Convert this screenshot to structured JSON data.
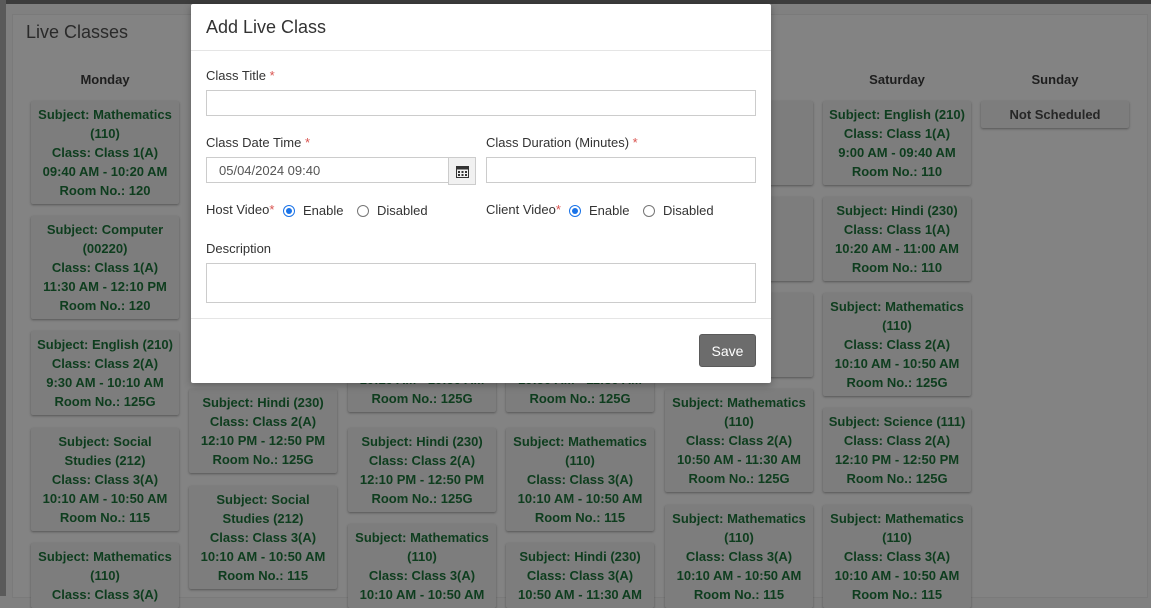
{
  "page": {
    "title": "Live Classes"
  },
  "days": [
    "Monday",
    "Saturday",
    "Sunday"
  ],
  "schedule": {
    "monday": [
      [
        "Subject: Mathematics",
        "(110)",
        "Class: Class 1(A)",
        "09:40 AM - 10:20 AM",
        "Room No.: 120"
      ],
      [
        "Subject: Computer",
        "(00220)",
        "Class: Class 1(A)",
        "11:30 AM - 12:10 PM",
        "Room No.: 120"
      ],
      [
        "Subject: English (210)",
        "Class: Class 2(A)",
        "9:30 AM - 10:10 AM",
        "Room No.: 125G"
      ],
      [
        "Subject: Social",
        "Studies (212)",
        "Class: Class 3(A)",
        "10:10 AM - 10:50 AM",
        "Room No.: 115"
      ],
      [
        "Subject: Mathematics",
        "(110)",
        "Class: Class 3(A)"
      ]
    ],
    "tuesday": [
      [
        "Subject: Hindi (230)",
        "Class: Class 2(A)",
        "12:10 PM - 12:50 PM",
        "Room No.: 125G"
      ],
      [
        "Subject: Social",
        "Studies (212)",
        "Class: Class 3(A)",
        "10:10 AM - 10:50 AM",
        "Room No.: 115"
      ]
    ],
    "wednesday": [
      [
        "10:10 AM - 10:50 AM",
        "Room No.: 125G"
      ],
      [
        "Subject: Hindi (230)",
        "Class: Class 2(A)",
        "12:10 PM - 12:50 PM",
        "Room No.: 125G"
      ],
      [
        "Subject: Mathematics",
        "(110)",
        "Class: Class 3(A)",
        "10:10 AM - 10:50 AM"
      ]
    ],
    "thursday": [
      [
        "10:50 AM - 11:30 AM",
        "Room No.: 125G"
      ],
      [
        "Subject: Mathematics",
        "(110)",
        "Class: Class 3(A)",
        "10:10 AM - 10:50 AM",
        "Room No.: 115"
      ],
      [
        "Subject: Hindi (230)",
        "Class: Class 3(A)",
        "10:50 AM - 11:30 AM"
      ]
    ],
    "friday": [
      [
        "(210)",
        "(A)",
        "0 AM",
        "10"
      ],
      [
        "(200)",
        "(A)",
        "0 PM",
        "10"
      ],
      [
        "(111)",
        "(A)",
        "0 AM",
        "5G"
      ],
      [
        "Subject: Mathematics",
        "(110)",
        "Class: Class 2(A)",
        "10:50 AM - 11:30 AM",
        "Room No.: 125G"
      ],
      [
        "Subject: Mathematics",
        "(110)",
        "Class: Class 3(A)",
        "10:10 AM - 10:50 AM",
        "Room No.: 115"
      ]
    ],
    "saturday": [
      [
        "Subject: English (210)",
        "Class: Class 1(A)",
        "9:00 AM - 09:40 AM",
        "Room No.: 110"
      ],
      [
        "Subject: Hindi (230)",
        "Class: Class 1(A)",
        "10:20 AM - 11:00 AM",
        "Room No.: 110"
      ],
      [
        "Subject: Mathematics",
        "(110)",
        "Class: Class 2(A)",
        "10:10 AM - 10:50 AM",
        "Room No.: 125G"
      ],
      [
        "Subject: Science (111)",
        "Class: Class 2(A)",
        "12:10 PM - 12:50 PM",
        "Room No.: 125G"
      ],
      [
        "Subject: Mathematics",
        "(110)",
        "Class: Class 3(A)",
        "10:10 AM - 10:50 AM",
        "Room No.: 115"
      ]
    ],
    "sunday": [
      [
        "Not Scheduled"
      ]
    ]
  },
  "modal": {
    "title": "Add Live Class",
    "class_title_label": "Class Title",
    "class_title_value": "",
    "date_time_label": "Class Date Time",
    "date_time_value": "05/04/2024 09:40",
    "duration_label": "Class Duration (Minutes)",
    "duration_value": "",
    "host_video_label": "Host Video",
    "client_video_label": "Client Video",
    "enable_label": "Enable",
    "disabled_label": "Disabled",
    "host_video_selected": "Enable",
    "client_video_selected": "Enable",
    "description_label": "Description",
    "description_value": "",
    "required_mark": "*",
    "save_label": "Save"
  },
  "icons": {
    "calendar": "calendar-icon"
  },
  "colors": {
    "subject_text": "#0e3d1e",
    "required": "#d9534f",
    "radio_selected": "#1a73e8",
    "save_button": "#6c6c6c"
  }
}
